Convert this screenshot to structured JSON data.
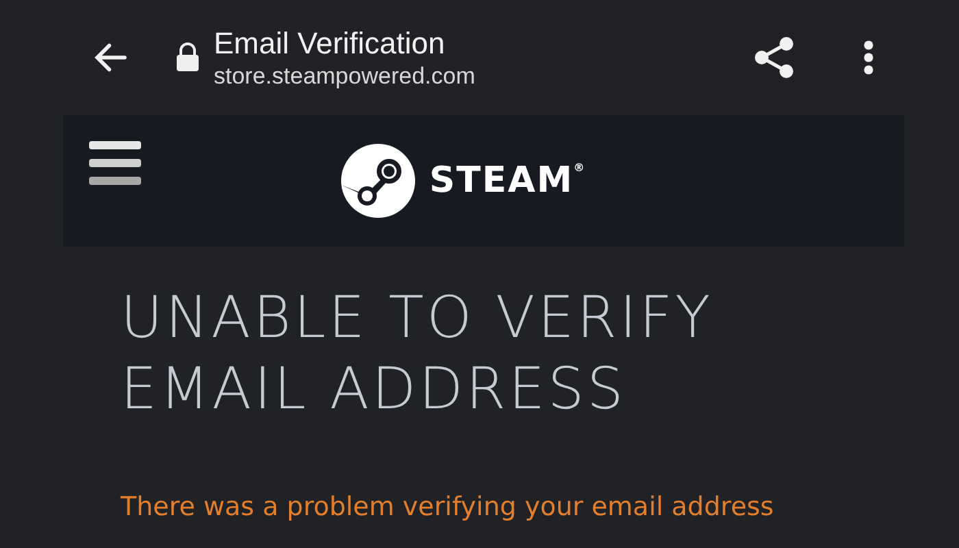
{
  "browser_bar": {
    "title": "Email Verification",
    "url": "store.steampowered.com"
  },
  "site_header": {
    "logo": {
      "wordmark": "STEAM",
      "mark": "®"
    }
  },
  "content": {
    "heading": "UNABLE TO VERIFY EMAIL ADDRESS",
    "message": "There was a problem verifying your email address"
  }
}
